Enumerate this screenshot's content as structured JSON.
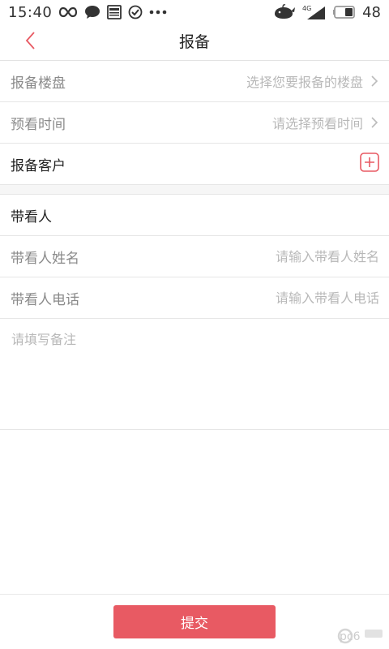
{
  "status_bar": {
    "time": "15:40",
    "network": "4G",
    "battery": "48",
    "icons": [
      "infinity-icon",
      "chat-bubble-icon",
      "news-icon",
      "check-circle-icon",
      "more-dots-icon",
      "whale-icon",
      "signal-icon",
      "battery-icon"
    ]
  },
  "header": {
    "title": "报备",
    "back_icon": "chevron-left-icon"
  },
  "form": {
    "property": {
      "label": "报备楼盘",
      "placeholder": "选择您要报备的楼盘"
    },
    "visit_time": {
      "label": "预看时间",
      "placeholder": "请选择预看时间"
    },
    "customer": {
      "label": "报备客户",
      "add_icon": "plus-square-icon"
    },
    "guide_section": {
      "label": "带看人"
    },
    "guide_name": {
      "label": "带看人姓名",
      "placeholder": "请输入带看人姓名"
    },
    "guide_phone": {
      "label": "带看人电话",
      "placeholder": "请输入带看人电话"
    },
    "remark": {
      "placeholder": "请填写备注"
    }
  },
  "footer": {
    "submit_label": "提交"
  },
  "watermark": {
    "text": "pc6"
  },
  "colors": {
    "accent": "#e85a63",
    "placeholder": "#b8b8b8",
    "divider": "#e6e6e6"
  }
}
